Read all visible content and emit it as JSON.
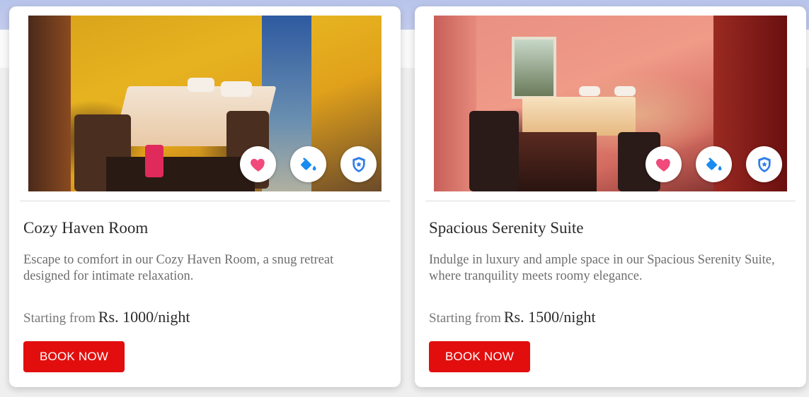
{
  "colors": {
    "accent": "#e20e0e",
    "heart": "#f0497a",
    "paint": "#1a8cf0",
    "shield": "#2f7de9"
  },
  "icons": [
    "heart-icon",
    "paint-bucket-icon",
    "shield-icon"
  ],
  "rooms": [
    {
      "title": "Cozy Haven Room",
      "description": "Escape to comfort in our Cozy Haven Room, a snug retreat designed for intimate relaxation.",
      "price_label": "Starting from",
      "price_value": "Rs. 1000/night",
      "button_label": "BOOK NOW"
    },
    {
      "title": "Spacious Serenity Suite",
      "description": "Indulge in luxury and ample space in our Spacious Serenity Suite, where tranquility meets roomy elegance.",
      "price_label": "Starting from",
      "price_value": "Rs. 1500/night",
      "button_label": "BOOK NOW"
    }
  ]
}
